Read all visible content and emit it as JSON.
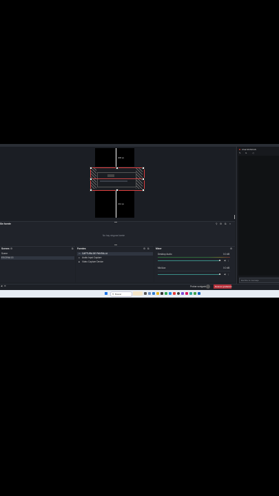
{
  "canvas": {
    "top_label": "208 px",
    "bottom_label": "214 px"
  },
  "filters": {
    "title": "Sin fuente",
    "empty_text": "No hay ninguna fuente"
  },
  "scenes": {
    "title": "Scenes",
    "items": [
      "Scene",
      "ESCENA 13"
    ]
  },
  "sources": {
    "title": "Fuentes",
    "items": [
      "CAPTURA DE PANTALLA",
      "Audio Input Capture",
      "Video Capture Device"
    ]
  },
  "mixer": {
    "title": "Mixer",
    "channels": [
      {
        "name": "Desktop Audio",
        "level": "0.0 dB"
      },
      {
        "name": "Mic/Aux",
        "level": "0.0 dB"
      }
    ]
  },
  "chat": {
    "title": "Chat MUSICAS",
    "input_placeholder": "Escribe tu mensaje"
  },
  "status": {
    "stream_label": "Probar sonigado",
    "record_button": "Detener grabación"
  },
  "taskbar": {
    "search_placeholder": "Buscar"
  },
  "colors": {
    "accent": "#3b8d86",
    "record_red": "#b6303a",
    "background": "#1d2026"
  }
}
